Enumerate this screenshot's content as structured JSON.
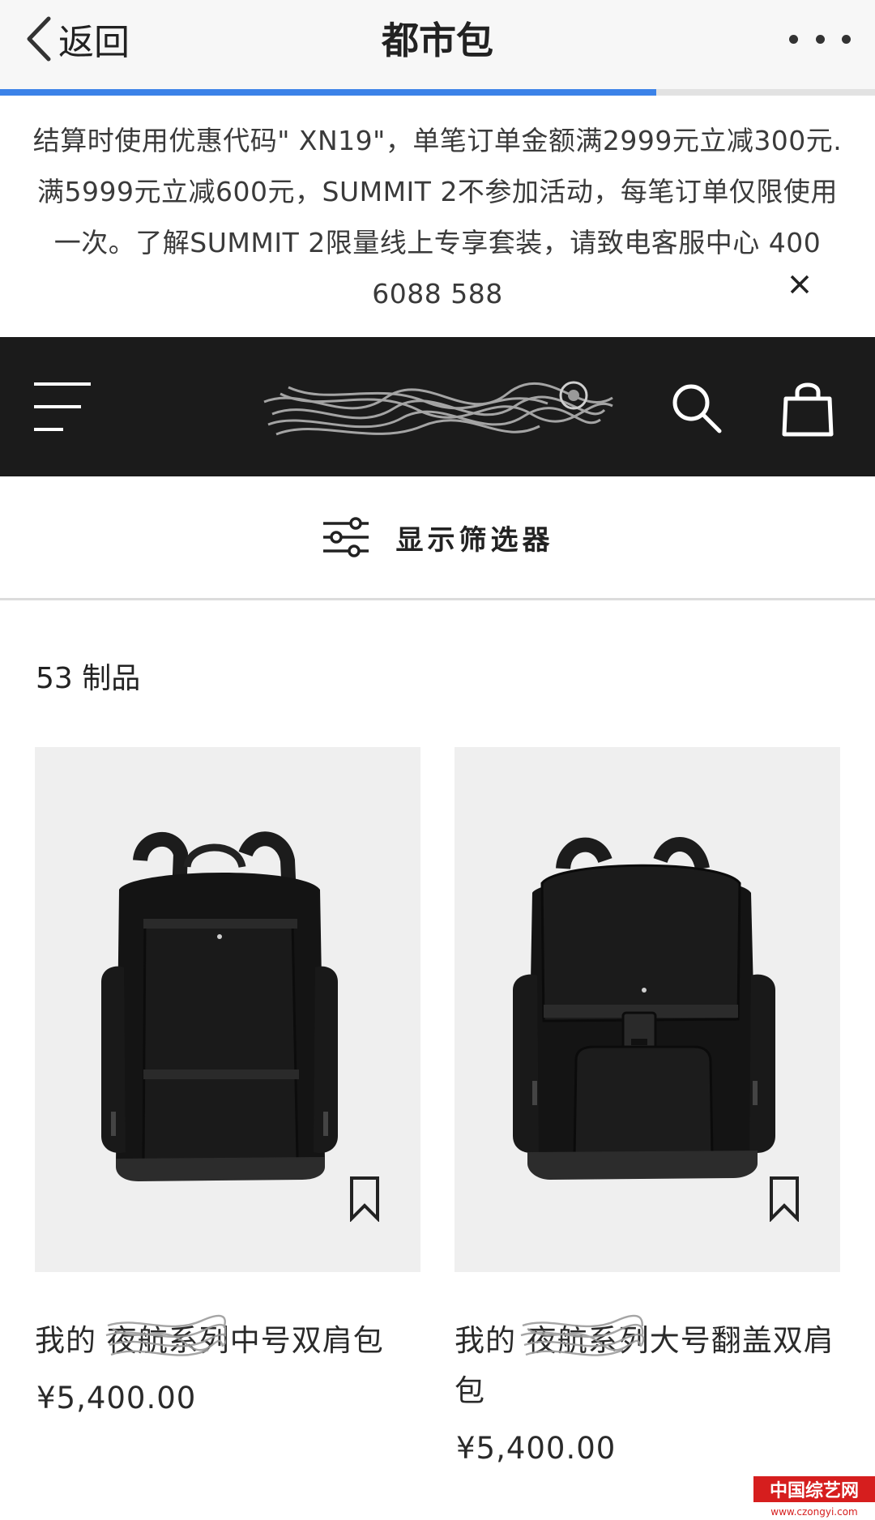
{
  "nav": {
    "back_label": "返回",
    "title": "都市包",
    "more_icon": "more-dots-icon",
    "load_progress": 0.75,
    "progress_color": "#3b82e8"
  },
  "promo": {
    "text": "结算时使用优惠代码\" XN19\"，单笔订单金额满2999元立减300元. 满5999元立减600元，SUMMIT 2不参加活动，每笔订单仅限使用一次。了解SUMMIT 2限量线上专享套装，请致电客服中心 400 6088 588",
    "close_icon": "close-icon"
  },
  "header": {
    "background": "#1b1b1b",
    "menu_icon": "hamburger-menu-icon",
    "logo_icon": "brand-logo-obscured",
    "search_icon": "search-icon",
    "bag_icon": "shopping-bag-icon"
  },
  "filter": {
    "label": "显示筛选器",
    "icon": "filter-sliders-icon"
  },
  "results": {
    "count_label": "53 制品"
  },
  "products": [
    {
      "name": "我的      夜航系列中号双肩包",
      "price": "¥5,400.00",
      "bookmark_icon": "bookmark-icon"
    },
    {
      "name": "我的      夜航系列大号翻盖双肩包",
      "price": "¥5,400.00",
      "bookmark_icon": "bookmark-icon"
    }
  ],
  "watermark": {
    "text": "中国综艺网",
    "url_text": "www.czongyi.com"
  }
}
